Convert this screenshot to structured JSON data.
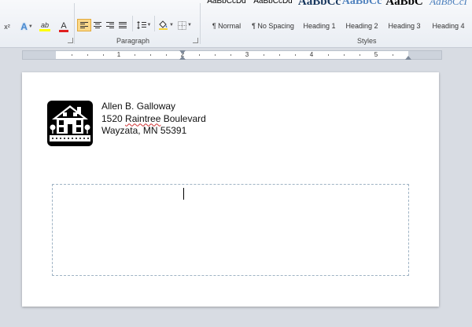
{
  "ribbon": {
    "font_group": {
      "superscript_label": "x²",
      "text_effects_label": "A",
      "highlight_label": "ab",
      "font_color_label": "A",
      "highlight_color": "#ffff00",
      "font_color": "#e02020"
    },
    "paragraph": {
      "label": "Paragraph",
      "buttons": [
        {
          "name": "align-left",
          "icon": "align-left-icon",
          "active": true
        },
        {
          "name": "align-center",
          "icon": "align-center-icon",
          "active": false
        },
        {
          "name": "align-right",
          "icon": "align-right-icon",
          "active": false
        },
        {
          "name": "justify",
          "icon": "justify-icon",
          "active": false
        },
        {
          "name": "line-spacing",
          "icon": "line-spacing-icon",
          "active": false
        },
        {
          "name": "shading",
          "icon": "paint-bucket-icon",
          "active": false
        },
        {
          "name": "borders",
          "icon": "borders-icon",
          "active": false
        }
      ]
    },
    "styles": {
      "label": "Styles",
      "items": [
        {
          "preview": "AaBbCcDd",
          "name": "¶ Normal"
        },
        {
          "preview": "AaBbCcDd",
          "name": "¶ No Spacing"
        },
        {
          "preview": "AaBbCc",
          "name": "Heading 1"
        },
        {
          "preview": "AaBbCc",
          "name": "Heading 2"
        },
        {
          "preview": "AaBbC",
          "name": "Heading 3"
        },
        {
          "preview": "AaBbCcI",
          "name": "Heading 4"
        }
      ]
    }
  },
  "ruler": {
    "numbers": [
      "1",
      "2",
      "3",
      "4",
      "5"
    ]
  },
  "document": {
    "return_address": {
      "name": "Allen B. Galloway",
      "street_number": "1520",
      "street_name": "Raintree",
      "street_suffix": "Boulevard",
      "city_line": "Wayzata, MN 55391"
    },
    "logo_icon": "house-icon"
  }
}
